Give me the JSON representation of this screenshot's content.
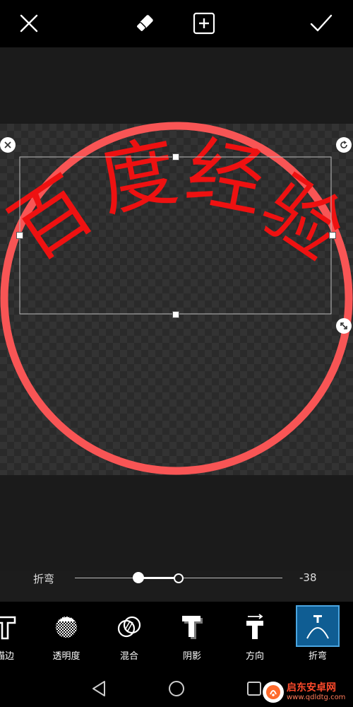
{
  "top_bar": {
    "close_icon": "close-x-icon",
    "eraser_icon": "eraser-icon",
    "add_icon": "plus-square-icon",
    "confirm_icon": "checkmark-icon"
  },
  "canvas": {
    "text_chars": [
      "百",
      "度",
      "经",
      "验"
    ],
    "text_color": "#ee1111",
    "circle_color": "#f85555"
  },
  "slider": {
    "label": "折弯",
    "value": "-38",
    "numeric_value": -38
  },
  "toolbar": {
    "items": [
      {
        "label": "描边",
        "icon": "text-outline-icon"
      },
      {
        "label": "透明度",
        "icon": "opacity-icon"
      },
      {
        "label": "混合",
        "icon": "blend-icon"
      },
      {
        "label": "阴影",
        "icon": "text-shadow-icon"
      },
      {
        "label": "方向",
        "icon": "text-direction-icon"
      },
      {
        "label": "折弯",
        "icon": "text-bend-icon"
      }
    ],
    "active": "折弯"
  },
  "navbar": {
    "back_icon": "back-triangle-icon",
    "home_icon": "home-circle-icon",
    "recents_icon": "recents-square-icon"
  },
  "watermark": {
    "main": "启东安卓网",
    "sub": "www.qdldtg.com"
  },
  "colors": {
    "accent": "#0f5d93",
    "background": "#1c1c1c"
  }
}
